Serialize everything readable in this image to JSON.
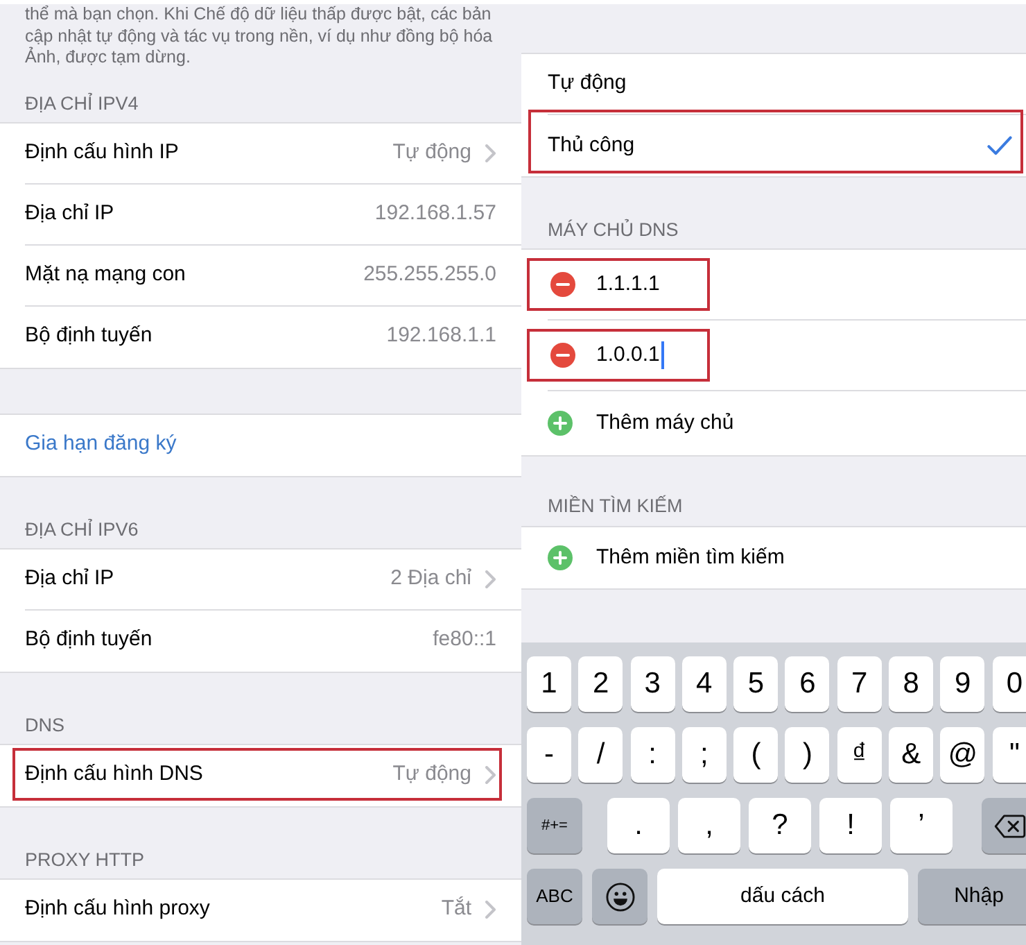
{
  "left_panel": {
    "footer_note": "thể mà bạn chọn. Khi Chế độ dữ liệu thấp được bật, các bản cập nhật tự động và tác vụ trong nền, ví dụ như đồng bộ hóa Ảnh, được tạm dừng.",
    "sections": [
      {
        "header": "ĐỊA CHỈ IPV4",
        "rows": [
          {
            "kind": "setting",
            "label": "Định cấu hình IP",
            "value": "Tự động",
            "chevron": true,
            "highlighted": false
          },
          {
            "kind": "setting",
            "label": "Địa chỉ IP",
            "value": "192.168.1.57",
            "chevron": false,
            "highlighted": false
          },
          {
            "kind": "setting",
            "label": "Mặt nạ mạng con",
            "value": "255.255.255.0",
            "chevron": false,
            "highlighted": false
          },
          {
            "kind": "setting",
            "label": "Bộ định tuyến",
            "value": "192.168.1.1",
            "chevron": false,
            "highlighted": false
          }
        ]
      },
      {
        "rows": [
          {
            "kind": "link",
            "label": "Gia hạn đăng ký",
            "chevron": false,
            "highlighted": false
          }
        ]
      },
      {
        "header": "ĐỊA CHỈ IPV6",
        "rows": [
          {
            "kind": "setting",
            "label": "Địa chỉ IP",
            "value": "2 Địa chỉ",
            "chevron": true,
            "highlighted": false
          },
          {
            "kind": "setting",
            "label": "Bộ định tuyến",
            "value": "fe80::1",
            "chevron": false,
            "highlighted": false
          }
        ]
      },
      {
        "header": "DNS",
        "rows": [
          {
            "kind": "setting",
            "label": "Định cấu hình DNS",
            "value": "Tự động",
            "chevron": true,
            "highlighted": true
          }
        ]
      },
      {
        "header": "PROXY HTTP",
        "rows": [
          {
            "kind": "setting",
            "label": "Định cấu hình proxy",
            "value": "Tắt",
            "chevron": true,
            "highlighted": false
          }
        ]
      }
    ]
  },
  "right_panel": {
    "modes": [
      {
        "label": "Tự động",
        "selected": false,
        "highlighted": false
      },
      {
        "label": "Thủ công",
        "selected": true,
        "highlighted": true
      }
    ],
    "dns_servers": {
      "header": "MÁY CHỦ DNS",
      "servers": [
        {
          "address": "1.1.1.1",
          "focused": false,
          "highlighted": true
        },
        {
          "address": "1.0.0.1",
          "focused": true,
          "highlighted": true
        }
      ],
      "add_label": "Thêm máy chủ"
    },
    "search_domains": {
      "header": "MIỀN TÌM KIẾM",
      "add_label": "Thêm miền tìm kiếm"
    },
    "keyboard": {
      "rows": [
        {
          "keys": [
            {
              "kind": "char",
              "label": "1"
            },
            {
              "kind": "char",
              "label": "2"
            },
            {
              "kind": "char",
              "label": "3"
            },
            {
              "kind": "char",
              "label": "4"
            },
            {
              "kind": "char",
              "label": "5"
            },
            {
              "kind": "char",
              "label": "6"
            },
            {
              "kind": "char",
              "label": "7"
            },
            {
              "kind": "char",
              "label": "8"
            },
            {
              "kind": "char",
              "label": "9"
            },
            {
              "kind": "char",
              "label": "0"
            }
          ]
        },
        {
          "keys": [
            {
              "kind": "char",
              "label": "-"
            },
            {
              "kind": "char",
              "label": "/"
            },
            {
              "kind": "char",
              "label": ":"
            },
            {
              "kind": "char",
              "label": ";"
            },
            {
              "kind": "char",
              "label": "("
            },
            {
              "kind": "char",
              "label": ")"
            },
            {
              "kind": "char",
              "label": "₫"
            },
            {
              "kind": "char",
              "label": "&"
            },
            {
              "kind": "char",
              "label": "@"
            },
            {
              "kind": "char",
              "label": "\""
            }
          ]
        },
        {
          "keys": [
            {
              "kind": "alt",
              "label": "#+="
            },
            {
              "kind": "punct",
              "label": "."
            },
            {
              "kind": "punct",
              "label": ","
            },
            {
              "kind": "punct",
              "label": "?"
            },
            {
              "kind": "punct",
              "label": "!"
            },
            {
              "kind": "punct",
              "label": "’"
            },
            {
              "kind": "backspace"
            }
          ]
        },
        {
          "keys": [
            {
              "kind": "mode",
              "label": "ABC"
            },
            {
              "kind": "emoji"
            },
            {
              "kind": "space",
              "label": "dấu cách"
            },
            {
              "kind": "return",
              "label": "Nhập"
            }
          ]
        }
      ]
    }
  }
}
